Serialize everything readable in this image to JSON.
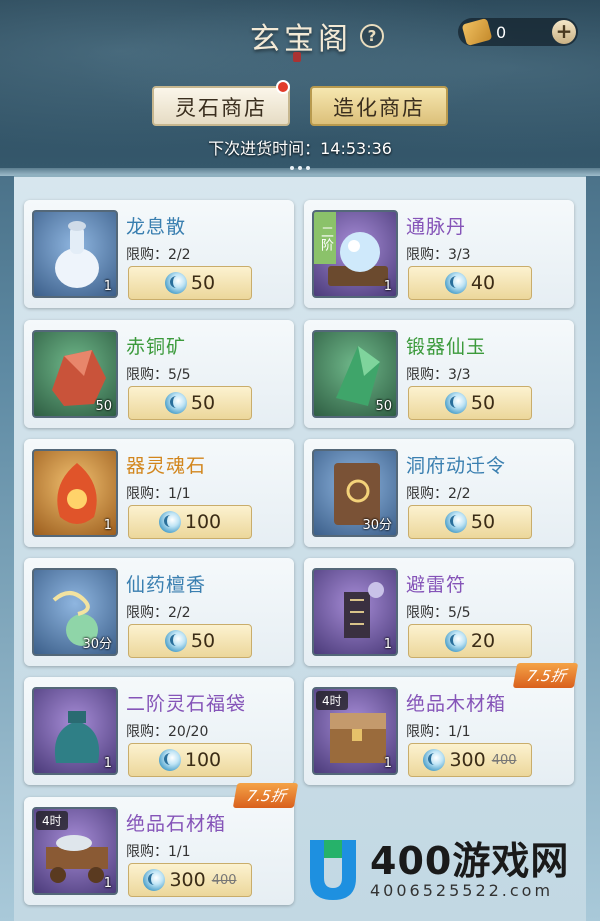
{
  "header": {
    "title": "玄宝阁",
    "help_icon": "?",
    "currency": {
      "icon": "scroll-token-icon",
      "value": "0",
      "plus": "+"
    },
    "tabs": [
      {
        "label": "灵石商店",
        "active": false,
        "badge": true
      },
      {
        "label": "造化商店",
        "active": true,
        "badge": false
      }
    ],
    "restock_label": "下次进货时间：",
    "restock_time": "14:53:36"
  },
  "items": [
    {
      "name": "龙息散",
      "limit": "限购：2/2",
      "price": "50",
      "qty": "1",
      "rarity": "blue",
      "name_color": "blue",
      "icon": "vase-icon"
    },
    {
      "name": "通脉丹",
      "limit": "限购：3/3",
      "price": "40",
      "qty": "1",
      "rarity": "purple",
      "name_color": "purple",
      "icon": "pearl-icon",
      "tag_vertical": "二阶"
    },
    {
      "name": "赤铜矿",
      "limit": "限购：5/5",
      "price": "50",
      "qty": "50",
      "rarity": "green",
      "name_color": "green",
      "icon": "red-ore-icon"
    },
    {
      "name": "锻器仙玉",
      "limit": "限购：3/3",
      "price": "50",
      "qty": "50",
      "rarity": "green",
      "name_color": "green",
      "icon": "jade-icon"
    },
    {
      "name": "器灵魂石",
      "limit": "限购：1/1",
      "price": "100",
      "qty": "1",
      "rarity": "gold",
      "name_color": "gold",
      "icon": "soul-stone-icon"
    },
    {
      "name": "洞府动迁令",
      "limit": "限购：2/2",
      "price": "50",
      "qty": "30分",
      "rarity": "blue",
      "name_color": "blue",
      "icon": "book-icon"
    },
    {
      "name": "仙药檀香",
      "limit": "限购：2/2",
      "price": "50",
      "qty": "30分",
      "rarity": "blue",
      "name_color": "blue",
      "icon": "incense-icon"
    },
    {
      "name": "避雷符",
      "limit": "限购：5/5",
      "price": "20",
      "qty": "1",
      "rarity": "purple",
      "name_color": "purple",
      "icon": "talisman-icon"
    },
    {
      "name": "二阶灵石福袋",
      "limit": "限购：20/20",
      "price": "100",
      "qty": "1",
      "rarity": "purple",
      "name_color": "purple",
      "icon": "bag-icon"
    },
    {
      "name": "绝品木材箱",
      "limit": "限购：1/1",
      "price": "300",
      "old_price": "400",
      "qty": "1",
      "rarity": "purple",
      "name_color": "purple",
      "icon": "wood-chest-icon",
      "tag": "4时",
      "discount": "7.5折"
    },
    {
      "name": "绝品石材箱",
      "limit": "限购：1/1",
      "price": "300",
      "old_price": "400",
      "qty": "1",
      "rarity": "purple",
      "name_color": "purple",
      "icon": "stone-cart-icon",
      "tag": "4时",
      "discount": "7.5折"
    }
  ],
  "brand": {
    "main": "400游戏网",
    "sub": "4006525522.com"
  },
  "colors": {
    "blue": "#3a7fb0",
    "purple": "#8554b8",
    "green": "#3b9a3b",
    "gold": "#d2861d"
  }
}
